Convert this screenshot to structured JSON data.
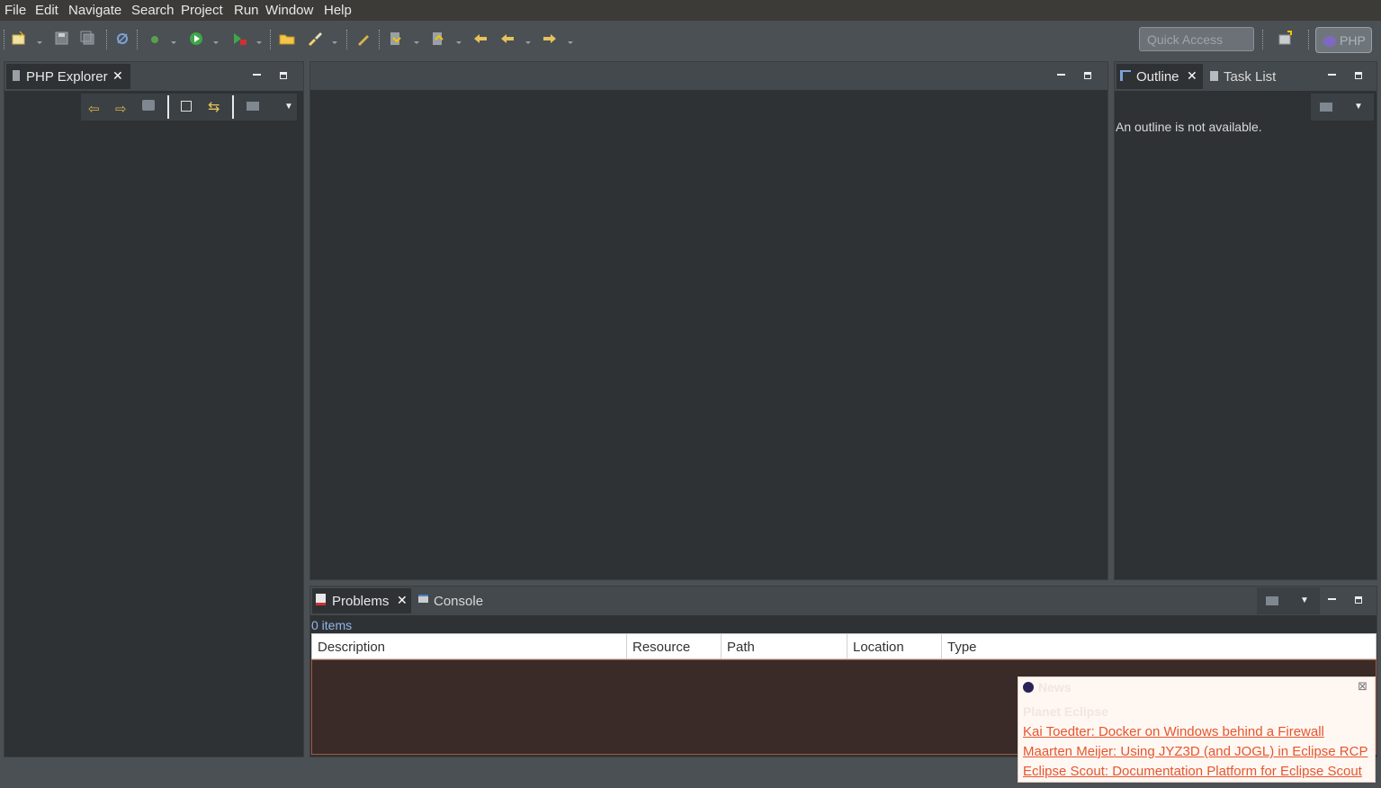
{
  "menu": {
    "items": [
      {
        "label": "File"
      },
      {
        "label": "Edit"
      },
      {
        "label": "Navigate"
      },
      {
        "label": "Search"
      },
      {
        "label": "Project"
      },
      {
        "label": "Run"
      },
      {
        "label": "Window"
      },
      {
        "label": "Help"
      }
    ]
  },
  "toolbar": {
    "quick_access_placeholder": "Quick Access",
    "perspective_label": "PHP"
  },
  "explorer": {
    "tab_label": "PHP Explorer"
  },
  "outline": {
    "tab_label": "Outline",
    "second_tab_label": "Task List",
    "empty_message": "An outline is not available."
  },
  "problems": {
    "tab_label": "Problems",
    "second_tab_label": "Console",
    "count": "0 items",
    "columns": [
      "Description",
      "Resource",
      "Path",
      "Location",
      "Type"
    ]
  },
  "news": {
    "title": "News",
    "section": "Planet Eclipse",
    "items": [
      "Kai Toedter: Docker on Windows behind a Firewall",
      "Maarten Meijer: Using JYZ3D (and JOGL)  in Eclipse RCP",
      "Eclipse Scout: Documentation Platform for Eclipse Scout"
    ]
  },
  "colors": {
    "link": "#e5562f",
    "panel_bg": "#2f3235",
    "chrome_bg": "#4b5054"
  }
}
